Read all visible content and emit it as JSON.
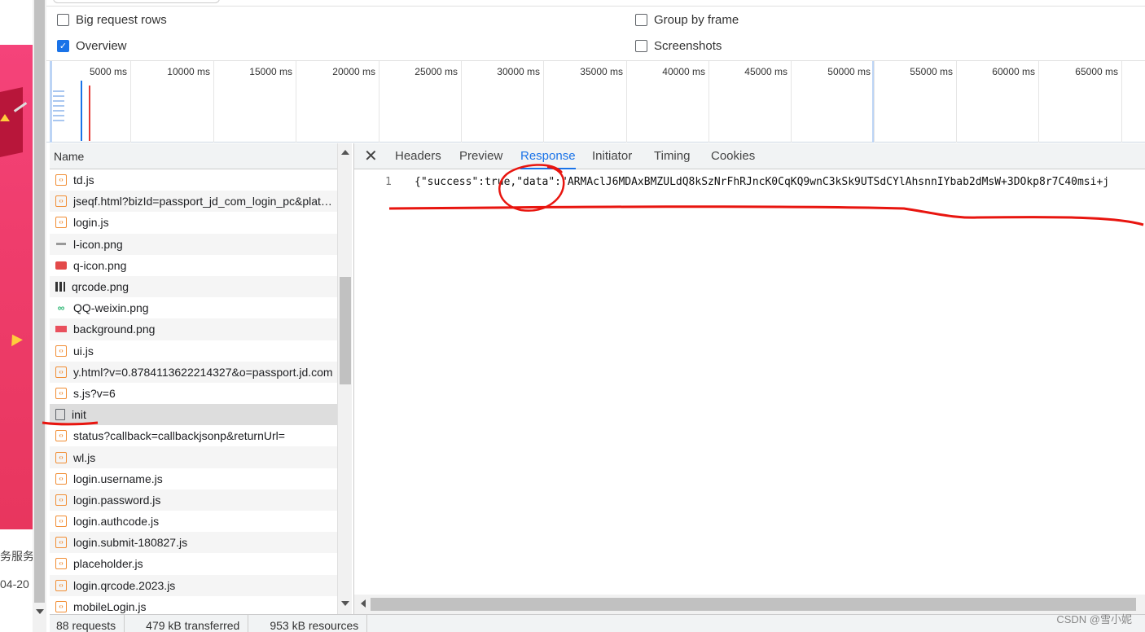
{
  "left_page": {
    "text_service": "务服务",
    "text_date": "04-20"
  },
  "options": {
    "big_request_rows": {
      "label": "Big request rows",
      "checked": false
    },
    "group_by_frame": {
      "label": "Group by frame",
      "checked": false
    },
    "overview": {
      "label": "Overview",
      "checked": true
    },
    "screenshots": {
      "label": "Screenshots",
      "checked": false
    }
  },
  "timeline": {
    "ticks": [
      "5000 ms",
      "10000 ms",
      "15000 ms",
      "20000 ms",
      "25000 ms",
      "30000 ms",
      "35000 ms",
      "40000 ms",
      "45000 ms",
      "50000 ms",
      "55000 ms",
      "60000 ms",
      "65000 ms"
    ]
  },
  "request_list": {
    "header": "Name",
    "rows": [
      {
        "name": "td.js",
        "type": "script"
      },
      {
        "name": "jseqf.html?bizId=passport_jd_com_login_pc&platform=js",
        "type": "script"
      },
      {
        "name": "login.js",
        "type": "script"
      },
      {
        "name": "l-icon.png",
        "type": "img-grey"
      },
      {
        "name": "q-icon.png",
        "type": "img-red"
      },
      {
        "name": "qrcode.png",
        "type": "img-qr"
      },
      {
        "name": "QQ-weixin.png",
        "type": "img-green"
      },
      {
        "name": "background.png",
        "type": "img-bg"
      },
      {
        "name": "ui.js",
        "type": "script"
      },
      {
        "name": "y.html?v=0.8784113622214327&o=passport.jd.com",
        "type": "script"
      },
      {
        "name": "s.js?v=6",
        "type": "script"
      },
      {
        "name": "init",
        "type": "doc",
        "selected": true
      },
      {
        "name": "status?callback=callbackjsonp&returnUrl=",
        "type": "script"
      },
      {
        "name": "wl.js",
        "type": "script"
      },
      {
        "name": "login.username.js",
        "type": "script"
      },
      {
        "name": "login.password.js",
        "type": "script"
      },
      {
        "name": "login.authcode.js",
        "type": "script"
      },
      {
        "name": "login.submit-180827.js",
        "type": "script"
      },
      {
        "name": "placeholder.js",
        "type": "script"
      },
      {
        "name": "login.qrcode.2023.js",
        "type": "script"
      },
      {
        "name": "mobileLogin.js",
        "type": "script"
      }
    ]
  },
  "detail": {
    "close_icon": "close-icon",
    "tabs": [
      "Headers",
      "Preview",
      "Response",
      "Initiator",
      "Timing",
      "Cookies"
    ],
    "active_tab": "Response",
    "response": {
      "line_number": "1",
      "code": "{\"success\":true,\"data\":\"ARMAclJ6MDAxBMZULdQ8kSzNrFhRJncK0CqKQ9wnC3kSk9UTSdCYlAhsnnIYbab2dMsW+3DOkp8r7C40msi+j"
    }
  },
  "status_bar": {
    "requests": "88 requests",
    "transferred": "479 kB transferred",
    "resources": "953 kB resources"
  },
  "watermark": "CSDN @雪小妮",
  "colors": {
    "accent": "#1a73e8",
    "annotation": "#e8150f",
    "script_icon": "#f18e35"
  }
}
